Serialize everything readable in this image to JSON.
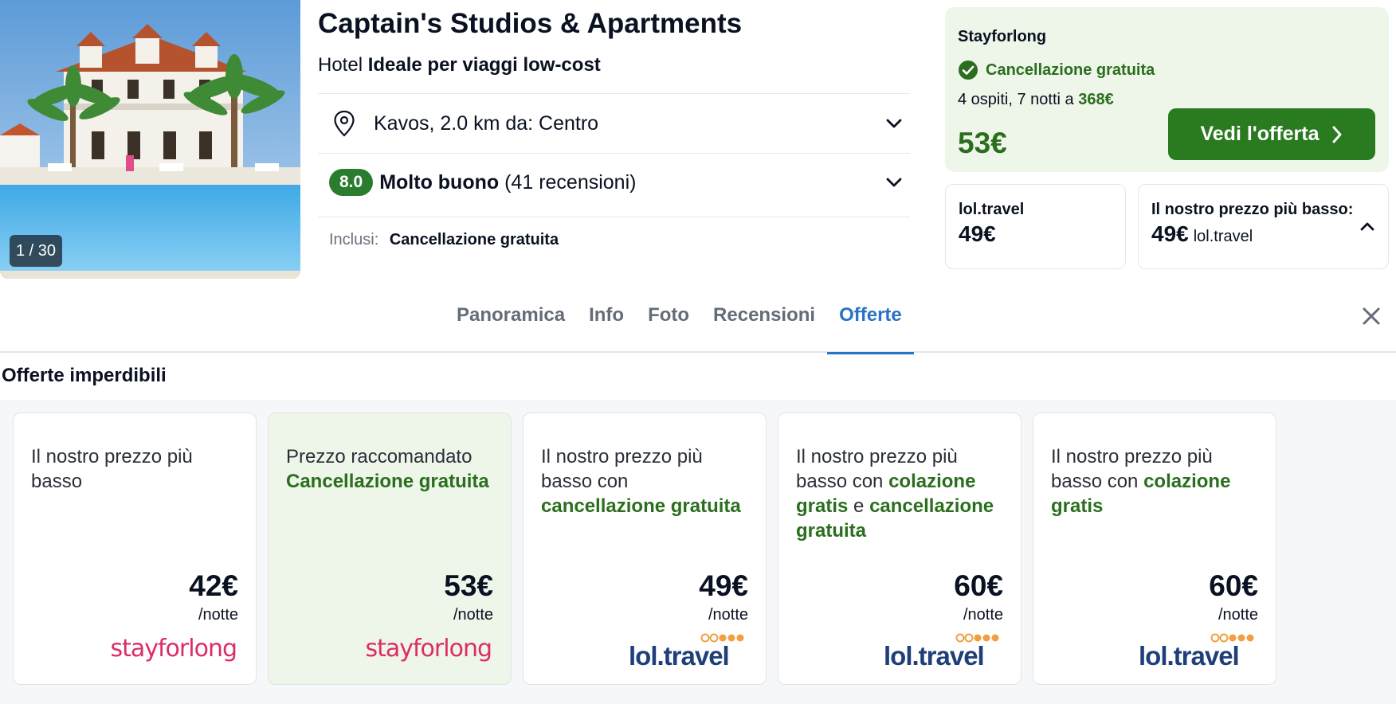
{
  "hotel": {
    "title": "Captain's Studios & Apartments",
    "type": "Hotel",
    "tagline": "Ideale per viaggi low-cost",
    "photo_counter": "1 / 30",
    "location": "Kavos, 2.0 km da: Centro",
    "rating_score": "8.0",
    "rating_label": "Molto buono",
    "rating_count": "(41 recensioni)",
    "included_label": "Inclusi:",
    "included_value": "Cancellazione gratuita"
  },
  "main_deal": {
    "provider": "Stayforlong",
    "cancellation": "Cancellazione gratuita",
    "stay_text": "4 ospiti, 7 notti a",
    "total_price": "368€",
    "price": "53€",
    "button_label": "Vedi l'offerta"
  },
  "mini_deals": [
    {
      "provider": "lol.travel",
      "price": "49€"
    },
    {
      "label": "Il nostro prezzo più basso:",
      "price": "49€",
      "provider": "lol.travel"
    }
  ],
  "tabs": [
    "Panoramica",
    "Info",
    "Foto",
    "Recensioni",
    "Offerte"
  ],
  "active_tab": "Offerte",
  "offers_title": "Offerte imperdibili",
  "offers": [
    {
      "head_plain": "Il nostro prezzo più basso",
      "price": "42€",
      "unit": "/notte",
      "logo": "stayforlong"
    },
    {
      "head_plain": "Prezzo raccomandato",
      "head_green": "Cancellazione gratuita",
      "price": "53€",
      "unit": "/notte",
      "logo": "stayforlong"
    },
    {
      "head_plain": "Il nostro prezzo più basso con",
      "head_green": "cancellazione gratuita",
      "price": "49€",
      "unit": "/notte",
      "logo": "lol.travel"
    },
    {
      "head_plain": "Il nostro prezzo più basso con",
      "head_green": "colazione gratis",
      "head_join": "e",
      "head_green2": "cancellazione gratuita",
      "price": "60€",
      "unit": "/notte",
      "logo": "lol.travel"
    },
    {
      "head_plain": "Il nostro prezzo più basso con",
      "head_green": "colazione gratis",
      "price": "60€",
      "unit": "/notte",
      "logo": "lol.travel"
    }
  ],
  "icons": {
    "location": "map-pin-icon",
    "expand": "chevron-down-icon",
    "collapse": "chevron-up-icon",
    "check": "check-circle-icon",
    "arrow": "chevron-right-icon",
    "close": "close-icon"
  },
  "colors": {
    "accent_green": "#2a7a1f",
    "deal_bg": "#eef5e9",
    "tab_active": "#2a72c4",
    "stayforlong_brand": "#dc2d65",
    "loltravel_brand": "#1f3f7a",
    "loltravel_dots": "#f0a040"
  }
}
